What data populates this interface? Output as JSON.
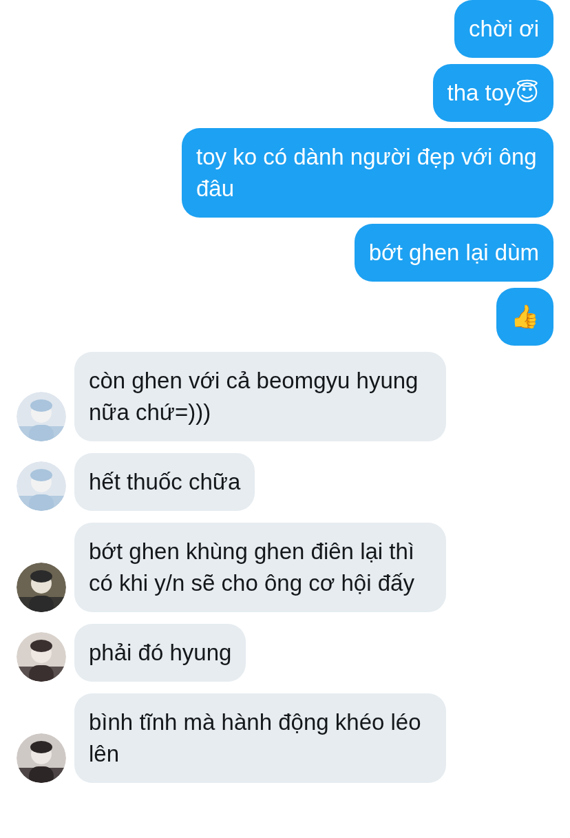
{
  "messages": [
    {
      "kind": "sent",
      "text": "chời ơi"
    },
    {
      "kind": "sent",
      "text": "tha toy😇"
    },
    {
      "kind": "sent",
      "text": "toy ko có dành người đẹp với ông đâu"
    },
    {
      "kind": "sent",
      "text": "bớt ghen lại dùm"
    },
    {
      "kind": "sent",
      "text": "👍"
    },
    {
      "kind": "received",
      "text": "còn ghen với cả beomgyu hyung nữa chứ=)))"
    },
    {
      "kind": "received",
      "text": "hết thuốc chữa"
    },
    {
      "kind": "received",
      "text": "bớt ghen khùng ghen điên lại thì có khi y/n sẽ cho ông cơ hội đấy"
    },
    {
      "kind": "received",
      "text": "phải đó hyung"
    },
    {
      "kind": "received",
      "text": "bình tĩnh mà hành động khéo léo lên"
    }
  ]
}
